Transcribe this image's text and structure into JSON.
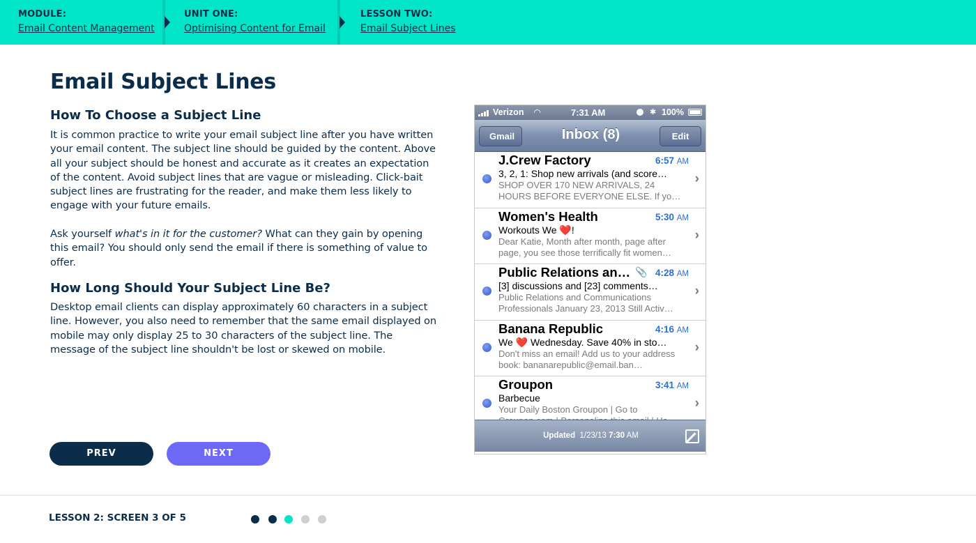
{
  "breadcrumb": {
    "module_label": "MODULE:",
    "module_value": "Email Content Management",
    "unit_label": "UNIT ONE:",
    "unit_value": "Optimising Content for Email",
    "lesson_label": "LESSON TWO:",
    "lesson_value": "Email Subject Lines"
  },
  "content": {
    "title": "Email Subject Lines",
    "section1_heading": "How To Choose a Subject Line",
    "section1_para": "It is common practice to write your email subject line after you have written your email content. The subject line should be guided by the content. Above all your subject should be honest and accurate as it creates an expectation of the content. Avoid subject lines that are vague or misleading. Click-bait subject lines are frustrating for the reader, and make them less likely to engage with your future emails.",
    "section1_para2_pre": "Ask yourself ",
    "section1_para2_em": "what's in it for the customer?",
    "section1_para2_post": " What can they gain by opening this email? You should only send the email if there is something of value to offer.",
    "section2_heading": "How Long Should Your Subject Line Be?",
    "section2_para": "Desktop email clients can display approximately 60 characters in a subject line. However, you also need to remember that the same email displayed on mobile may only display 25 to 30 characters of the subject line. The message of the subject line shouldn't be lost or skewed on mobile."
  },
  "nav": {
    "prev_label": "PREV",
    "next_label": "NEXT"
  },
  "footer": {
    "progress_label": "LESSON 2: SCREEN 3 OF 5",
    "current_screen": 3,
    "total_screens": 5,
    "colors": {
      "done": "#0b2d4a",
      "current": "#00e5c8",
      "todo": "#cfcfd2"
    }
  },
  "phone": {
    "status": {
      "carrier": "Verizon",
      "time": "7:31 AM",
      "battery": "100%"
    },
    "nav": {
      "back_label": "Gmail",
      "title": "Inbox (8)",
      "edit_label": "Edit"
    },
    "emails": [
      {
        "sender": "J.Crew Factory",
        "time": "6:57",
        "ampm": "AM",
        "subject": "3, 2, 1: Shop new arrivals (and score…",
        "preview": "SHOP OVER 170 NEW ARRIVALS, 24 HOURS BEFORE EVERYONE ELSE. If yo…"
      },
      {
        "sender": "Women's Health",
        "time": "5:30",
        "ampm": "AM",
        "subject": "Workouts We ❤️!",
        "preview": "Dear Katie, Month after month, page after page, you see those terrifically fit women…"
      },
      {
        "sender": "Public Relations an…",
        "time": "4:28",
        "ampm": "AM",
        "subject": "[3] discussions and [23] comments…",
        "preview": "Public Relations and Communications Professionals January 23, 2013 Still Activ…"
      },
      {
        "sender": "Banana Republic",
        "time": "4:16",
        "ampm": "AM",
        "subject": "We ❤️ Wednesday. Save 40% in sto…",
        "preview": "Don't miss an email! Add us to your address book: bananarepublic@email.ban…"
      },
      {
        "sender": "Groupon",
        "time": "3:41",
        "ampm": "AM",
        "subject": "Barbecue",
        "preview": "Your Daily Boston Groupon | Go to Groupon.com | Personalize this email | Ha…"
      }
    ],
    "toolbar": {
      "updated_label": "Updated",
      "updated_date": "1/23/13",
      "updated_time": "7:30",
      "updated_ampm": "AM"
    }
  }
}
